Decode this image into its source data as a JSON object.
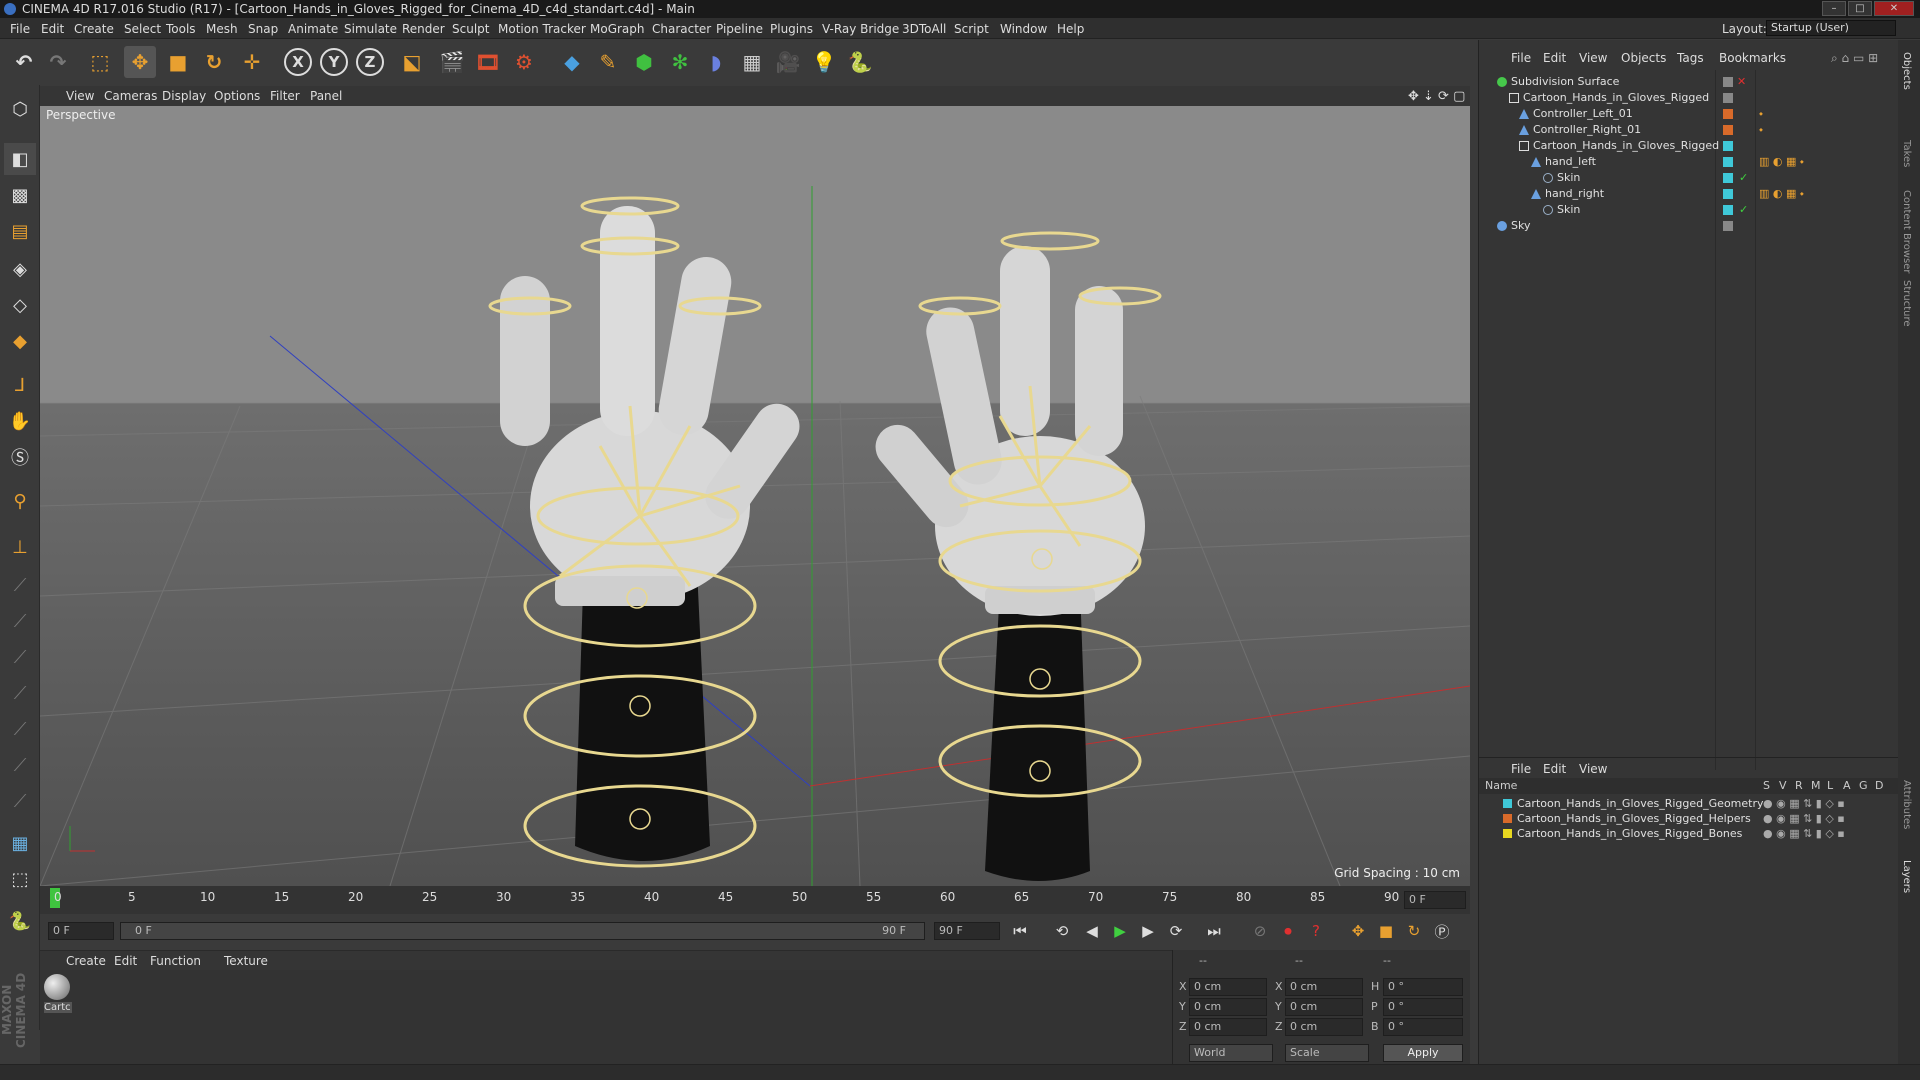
{
  "window": {
    "title": "CINEMA 4D R17.016 Studio (R17) - [Cartoon_Hands_in_Gloves_Rigged_for_Cinema_4D_c4d_standart.c4d] - Main"
  },
  "menubar": {
    "items": [
      "File",
      "Edit",
      "Create",
      "Select",
      "Tools",
      "Mesh",
      "Snap",
      "Animate",
      "Simulate",
      "Render",
      "Sculpt",
      "Motion Tracker",
      "MoGraph",
      "Character",
      "Pipeline",
      "Plugins",
      "V-Ray Bridge",
      "3DToAll",
      "Script",
      "Window",
      "Help"
    ],
    "layout_label": "Layout:",
    "layout_value": "Startup (User)"
  },
  "toolbar": {
    "icons": [
      "undo-icon",
      "redo-icon",
      "live-selection-icon",
      "move-icon",
      "scale-icon",
      "rotate-icon",
      "move-tool-icon",
      "x-axis-icon",
      "y-axis-icon",
      "z-axis-icon",
      "coordinate-system-icon",
      "render-view-icon",
      "render-picture-viewer-icon",
      "render-settings-icon",
      "cube-icon",
      "pen-icon",
      "subdivision-icon",
      "mograph-icon",
      "deformer-icon",
      "floor-icon",
      "camera-icon",
      "light-icon",
      "python-icon"
    ],
    "axis_labels": [
      "X",
      "Y",
      "Z"
    ]
  },
  "viewport": {
    "menu": [
      "View",
      "Cameras",
      "Display",
      "Options",
      "Filter",
      "Panel"
    ],
    "label": "Perspective",
    "grid_spacing": "Grid Spacing : 10 cm"
  },
  "timeline": {
    "ticks": [
      "0",
      "5",
      "10",
      "15",
      "20",
      "25",
      "30",
      "35",
      "40",
      "45",
      "50",
      "55",
      "60",
      "65",
      "70",
      "75",
      "80",
      "85",
      "90"
    ],
    "current_frame": "0 F",
    "start_field": "0 F",
    "range_start": "0 F",
    "range_end": "90 F",
    "end_field": "90 F"
  },
  "materials": {
    "menu": [
      "Create",
      "Edit",
      "Function",
      "Texture"
    ],
    "items": [
      {
        "label": "Cartc"
      }
    ]
  },
  "coordinates": {
    "header": [
      "--",
      "--",
      "--"
    ],
    "rows": [
      {
        "a": "X",
        "av": "0 cm",
        "b": "X",
        "bv": "0 cm",
        "c": "H",
        "cv": "0 °"
      },
      {
        "a": "Y",
        "av": "0 cm",
        "b": "Y",
        "bv": "0 cm",
        "c": "P",
        "cv": "0 °"
      },
      {
        "a": "Z",
        "av": "0 cm",
        "b": "Z",
        "bv": "0 cm",
        "c": "B",
        "cv": "0 °"
      }
    ],
    "space": "World",
    "mode": "Scale",
    "apply": "Apply"
  },
  "objects": {
    "menu": [
      "File",
      "Edit",
      "View",
      "Objects",
      "Tags",
      "Bookmarks"
    ],
    "tree": [
      {
        "label": "Subdivision Surface",
        "indent": 0,
        "icon_color": "#46c84b"
      },
      {
        "label": "Cartoon_Hands_in_Gloves_Rigged",
        "indent": 1,
        "icon_color": "#cccccc"
      },
      {
        "label": "Controller_Left_01",
        "indent": 2,
        "icon_color": "#6aa0e0"
      },
      {
        "label": "Controller_Right_01",
        "indent": 2,
        "icon_color": "#6aa0e0"
      },
      {
        "label": "Cartoon_Hands_in_Gloves_Rigged",
        "indent": 2,
        "icon_color": "#cccccc"
      },
      {
        "label": "hand_left",
        "indent": 3,
        "icon_color": "#6aa0e0"
      },
      {
        "label": "Skin",
        "indent": 4,
        "icon_color": "#9ab0c8"
      },
      {
        "label": "hand_right",
        "indent": 3,
        "icon_color": "#6aa0e0"
      },
      {
        "label": "Skin",
        "indent": 4,
        "icon_color": "#9ab0c8"
      },
      {
        "label": "Sky",
        "indent": 0,
        "icon_color": "#6aa0e0"
      }
    ]
  },
  "layers": {
    "menu": [
      "File",
      "Edit",
      "View"
    ],
    "columns": [
      "Name",
      "S",
      "V",
      "R",
      "M",
      "L",
      "A",
      "G",
      "D"
    ],
    "items": [
      {
        "name": "Cartoon_Hands_in_Gloves_Rigged_Geometry",
        "color": "#3fc8d8"
      },
      {
        "name": "Cartoon_Hands_in_Gloves_Rigged_Helpers",
        "color": "#d86a2a"
      },
      {
        "name": "Cartoon_Hands_in_Gloves_Rigged_Bones",
        "color": "#e8d820"
      }
    ]
  },
  "side_tabs": [
    "Objects",
    "Takes",
    "Content Browser",
    "Structure",
    "Attributes",
    "Layers"
  ],
  "brand": "MAXON CINEMA 4D"
}
